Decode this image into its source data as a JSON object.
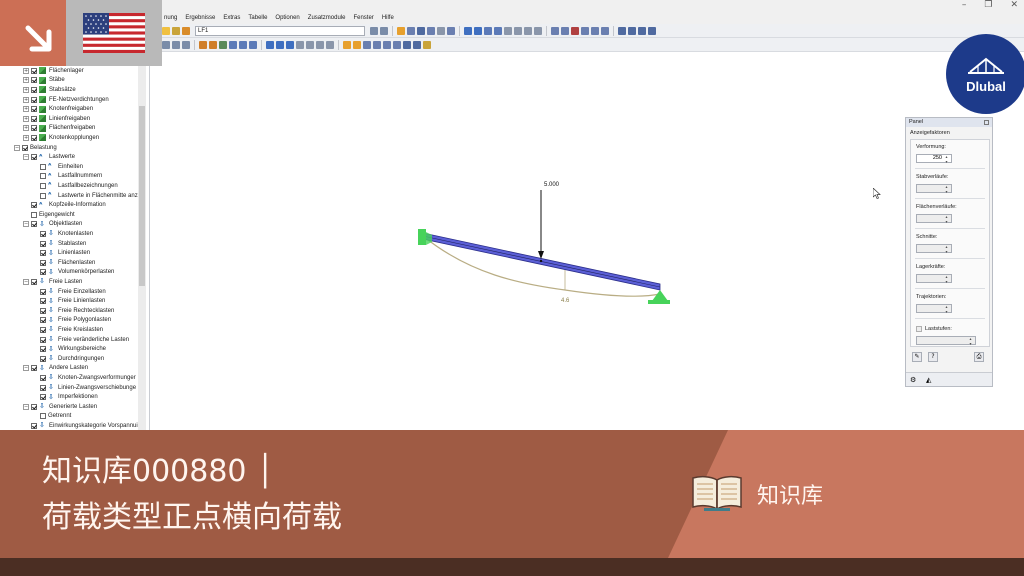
{
  "window": {
    "menu": [
      "nung",
      "Ergebnisse",
      "Extras",
      "Tabelle",
      "Optionen",
      "Zusatzmodule",
      "Fenster",
      "Hilfe"
    ],
    "load_case": "LF1",
    "window_controls": [
      "–",
      "❐",
      "✕"
    ]
  },
  "navigator": {
    "items": [
      {
        "label": "Flächenlager",
        "indent": 1,
        "exp": "+",
        "check": true,
        "icon": "green"
      },
      {
        "label": "Stäbe",
        "indent": 1,
        "exp": "+",
        "check": true,
        "icon": "green"
      },
      {
        "label": "Stabsätze",
        "indent": 1,
        "exp": "+",
        "check": true,
        "icon": "green"
      },
      {
        "label": "FE-Netzverdichtungen",
        "indent": 1,
        "exp": "+",
        "check": true,
        "icon": "green"
      },
      {
        "label": "Knotenfreigaben",
        "indent": 1,
        "exp": "+",
        "check": true,
        "icon": "green"
      },
      {
        "label": "Linienfreigaben",
        "indent": 1,
        "exp": "+",
        "check": true,
        "icon": "green"
      },
      {
        "label": "Flächenfreigaben",
        "indent": 1,
        "exp": "+",
        "check": true,
        "icon": "green"
      },
      {
        "label": "Knotenkopplungen",
        "indent": 1,
        "exp": "+",
        "check": true,
        "icon": "green"
      },
      {
        "label": "Belastung",
        "indent": 0,
        "exp": "−",
        "check": true,
        "icon": "none"
      },
      {
        "label": "Lastwerte",
        "indent": 1,
        "exp": "−",
        "check": true,
        "icon": "label"
      },
      {
        "label": "Einheiten",
        "indent": 2,
        "exp": "",
        "check": false,
        "icon": "label"
      },
      {
        "label": "Lastfallnummern",
        "indent": 2,
        "exp": "",
        "check": false,
        "icon": "label"
      },
      {
        "label": "Lastfallbezeichnungen",
        "indent": 2,
        "exp": "",
        "check": false,
        "icon": "label"
      },
      {
        "label": "Lastwerte in Flächenmitte anz",
        "indent": 2,
        "exp": "",
        "check": false,
        "icon": "label"
      },
      {
        "label": "Kopfzeile-Information",
        "indent": 1,
        "exp": "",
        "check": true,
        "icon": "label"
      },
      {
        "label": "Eigengewicht",
        "indent": 1,
        "exp": "",
        "check": false,
        "icon": "none"
      },
      {
        "label": "Objektlasten",
        "indent": 1,
        "exp": "−",
        "check": true,
        "icon": "load"
      },
      {
        "label": "Knotenlasten",
        "indent": 2,
        "exp": "",
        "check": true,
        "icon": "load"
      },
      {
        "label": "Stablasten",
        "indent": 2,
        "exp": "",
        "check": true,
        "icon": "load"
      },
      {
        "label": "Linienlasten",
        "indent": 2,
        "exp": "",
        "check": true,
        "icon": "load"
      },
      {
        "label": "Flächenlasten",
        "indent": 2,
        "exp": "",
        "check": true,
        "icon": "load"
      },
      {
        "label": "Volumenkörperlasten",
        "indent": 2,
        "exp": "",
        "check": true,
        "icon": "load"
      },
      {
        "label": "Freie Lasten",
        "indent": 1,
        "exp": "−",
        "check": true,
        "icon": "load"
      },
      {
        "label": "Freie Einzellasten",
        "indent": 2,
        "exp": "",
        "check": true,
        "icon": "load"
      },
      {
        "label": "Freie Linienlasten",
        "indent": 2,
        "exp": "",
        "check": true,
        "icon": "load"
      },
      {
        "label": "Freie Rechtecklasten",
        "indent": 2,
        "exp": "",
        "check": true,
        "icon": "load"
      },
      {
        "label": "Freie Polygonlasten",
        "indent": 2,
        "exp": "",
        "check": true,
        "icon": "load"
      },
      {
        "label": "Freie Kreislasten",
        "indent": 2,
        "exp": "",
        "check": true,
        "icon": "load"
      },
      {
        "label": "Freie veränderliche Lasten",
        "indent": 2,
        "exp": "",
        "check": true,
        "icon": "load"
      },
      {
        "label": "Wirkungsbereiche",
        "indent": 2,
        "exp": "",
        "check": true,
        "icon": "load"
      },
      {
        "label": "Durchdringungen",
        "indent": 2,
        "exp": "",
        "check": true,
        "icon": "load"
      },
      {
        "label": "Andere Lasten",
        "indent": 1,
        "exp": "−",
        "check": true,
        "icon": "load"
      },
      {
        "label": "Knoten-Zwangsverformunger",
        "indent": 2,
        "exp": "",
        "check": true,
        "icon": "load"
      },
      {
        "label": "Linien-Zwangsverschiebunge",
        "indent": 2,
        "exp": "",
        "check": true,
        "icon": "load"
      },
      {
        "label": "Imperfektionen",
        "indent": 2,
        "exp": "",
        "check": true,
        "icon": "load"
      },
      {
        "label": "Generierte Lasten",
        "indent": 1,
        "exp": "−",
        "check": true,
        "icon": "load"
      },
      {
        "label": "Getrennt",
        "indent": 2,
        "exp": "",
        "check": false,
        "icon": "none"
      },
      {
        "label": "Einwirkungskategorie Vorspannui",
        "indent": 1,
        "exp": "",
        "check": true,
        "icon": "load"
      }
    ]
  },
  "model": {
    "load_value": "5.000",
    "deformation_value": "4.6",
    "beam_color": "#5b5fd6",
    "support_color": "#47d35a",
    "deformation_color": "#b9ad84"
  },
  "panel": {
    "title": "Panel",
    "heading": "Anzeigefaktoren",
    "fields": [
      {
        "label": "Verformung:",
        "value": "250",
        "enabled": true
      },
      {
        "label": "Stabverläufe:",
        "value": "",
        "enabled": false
      },
      {
        "label": "Flächenverläufe:",
        "value": "",
        "enabled": false
      },
      {
        "label": "Schnitte:",
        "value": "",
        "enabled": false
      },
      {
        "label": "Lagerkräfte:",
        "value": "",
        "enabled": false
      },
      {
        "label": "Trajektorien:",
        "value": "",
        "enabled": false
      }
    ],
    "laststufen_label": "Laststufen:"
  },
  "brand": {
    "name": "Dlubal",
    "color": "#1d3a8a"
  },
  "banner": {
    "line1": "知识库000880 │",
    "line2": "荷载类型正点横向荷载",
    "kb_label": "知识库",
    "color_main": "#9f5b44",
    "color_right": "#c8775f"
  }
}
